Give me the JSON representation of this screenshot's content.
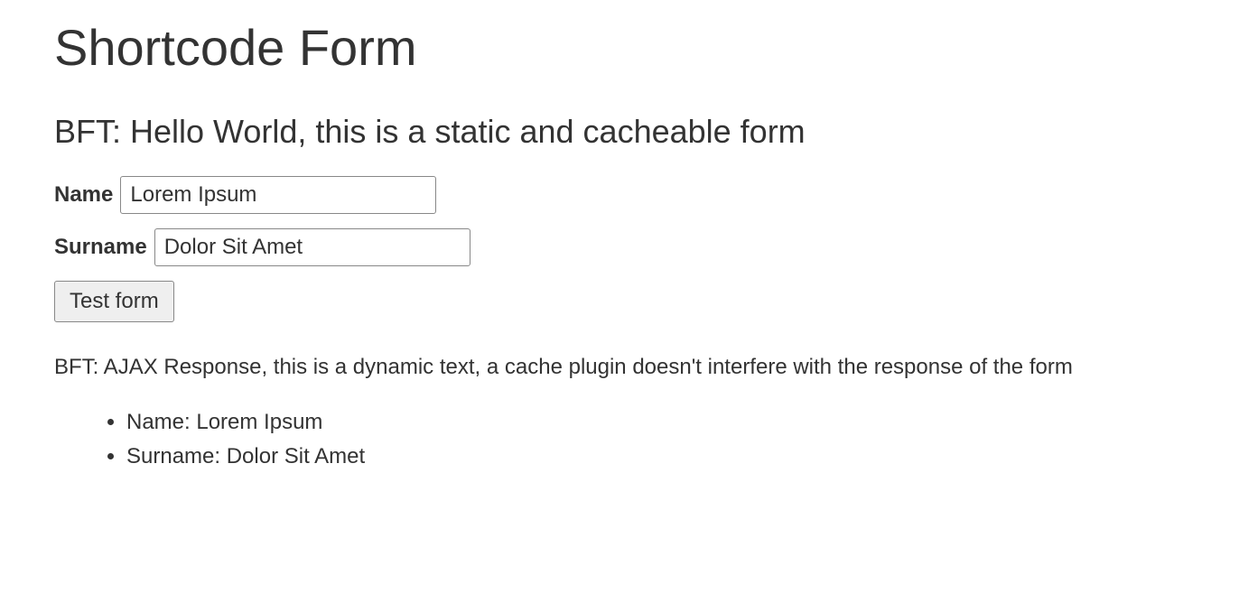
{
  "page": {
    "title": "Shortcode Form",
    "subtitle": "BFT: Hello World, this is a static and cacheable form"
  },
  "form": {
    "name_label": "Name",
    "name_value": "Lorem Ipsum",
    "surname_label": "Surname",
    "surname_value": "Dolor Sit Amet",
    "submit_label": "Test form"
  },
  "response": {
    "text": "BFT: AJAX Response, this is a dynamic text, a cache plugin doesn't interfere with the response of the form",
    "items": {
      "name": "Name: Lorem Ipsum",
      "surname": "Surname: Dolor Sit Amet"
    }
  }
}
